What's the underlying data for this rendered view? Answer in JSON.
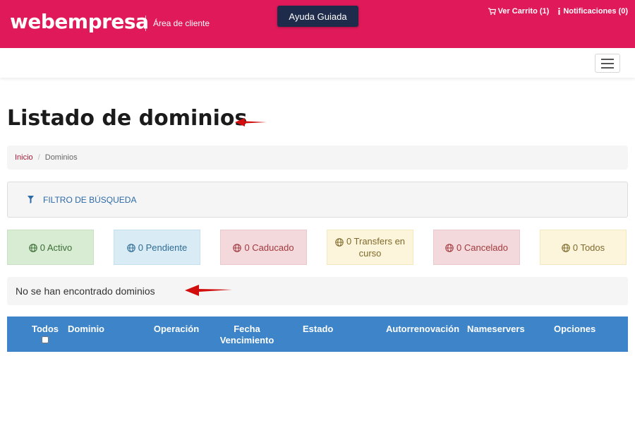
{
  "header": {
    "logo_text": "webempresa",
    "area_label": "Área de cliente",
    "help_button": "Ayuda Guiada",
    "cart_link": "Ver Carrito (1)",
    "notifications_link": "Notificaciones (0)",
    "brand_color": "#e0195a"
  },
  "page": {
    "title": "Listado de dominios"
  },
  "breadcrumb": {
    "home": "Inicio",
    "current": "Dominios"
  },
  "filter": {
    "label": "FILTRO DE BÚSQUEDA"
  },
  "status_filters": [
    {
      "label": "0 Activo",
      "color": "#d7ecd2"
    },
    {
      "label": "0 Pendiente",
      "color": "#d9ecf6"
    },
    {
      "label": "0 Caducado",
      "color": "#f3d9db"
    },
    {
      "label": "0 Transfers en curso",
      "color": "#fcf5db"
    },
    {
      "label": "0 Cancelado",
      "color": "#f3d9db"
    },
    {
      "label": "0 Todos",
      "color": "#fcf5db"
    }
  ],
  "empty_message": "No se han encontrado dominios",
  "table": {
    "header_color": "#3d85c8",
    "columns": [
      "Todos",
      "Dominio",
      "Operación",
      "Fecha Vencimiento",
      "Estado",
      "Autorrenovación",
      "Nameservers",
      "Opciones"
    ]
  }
}
